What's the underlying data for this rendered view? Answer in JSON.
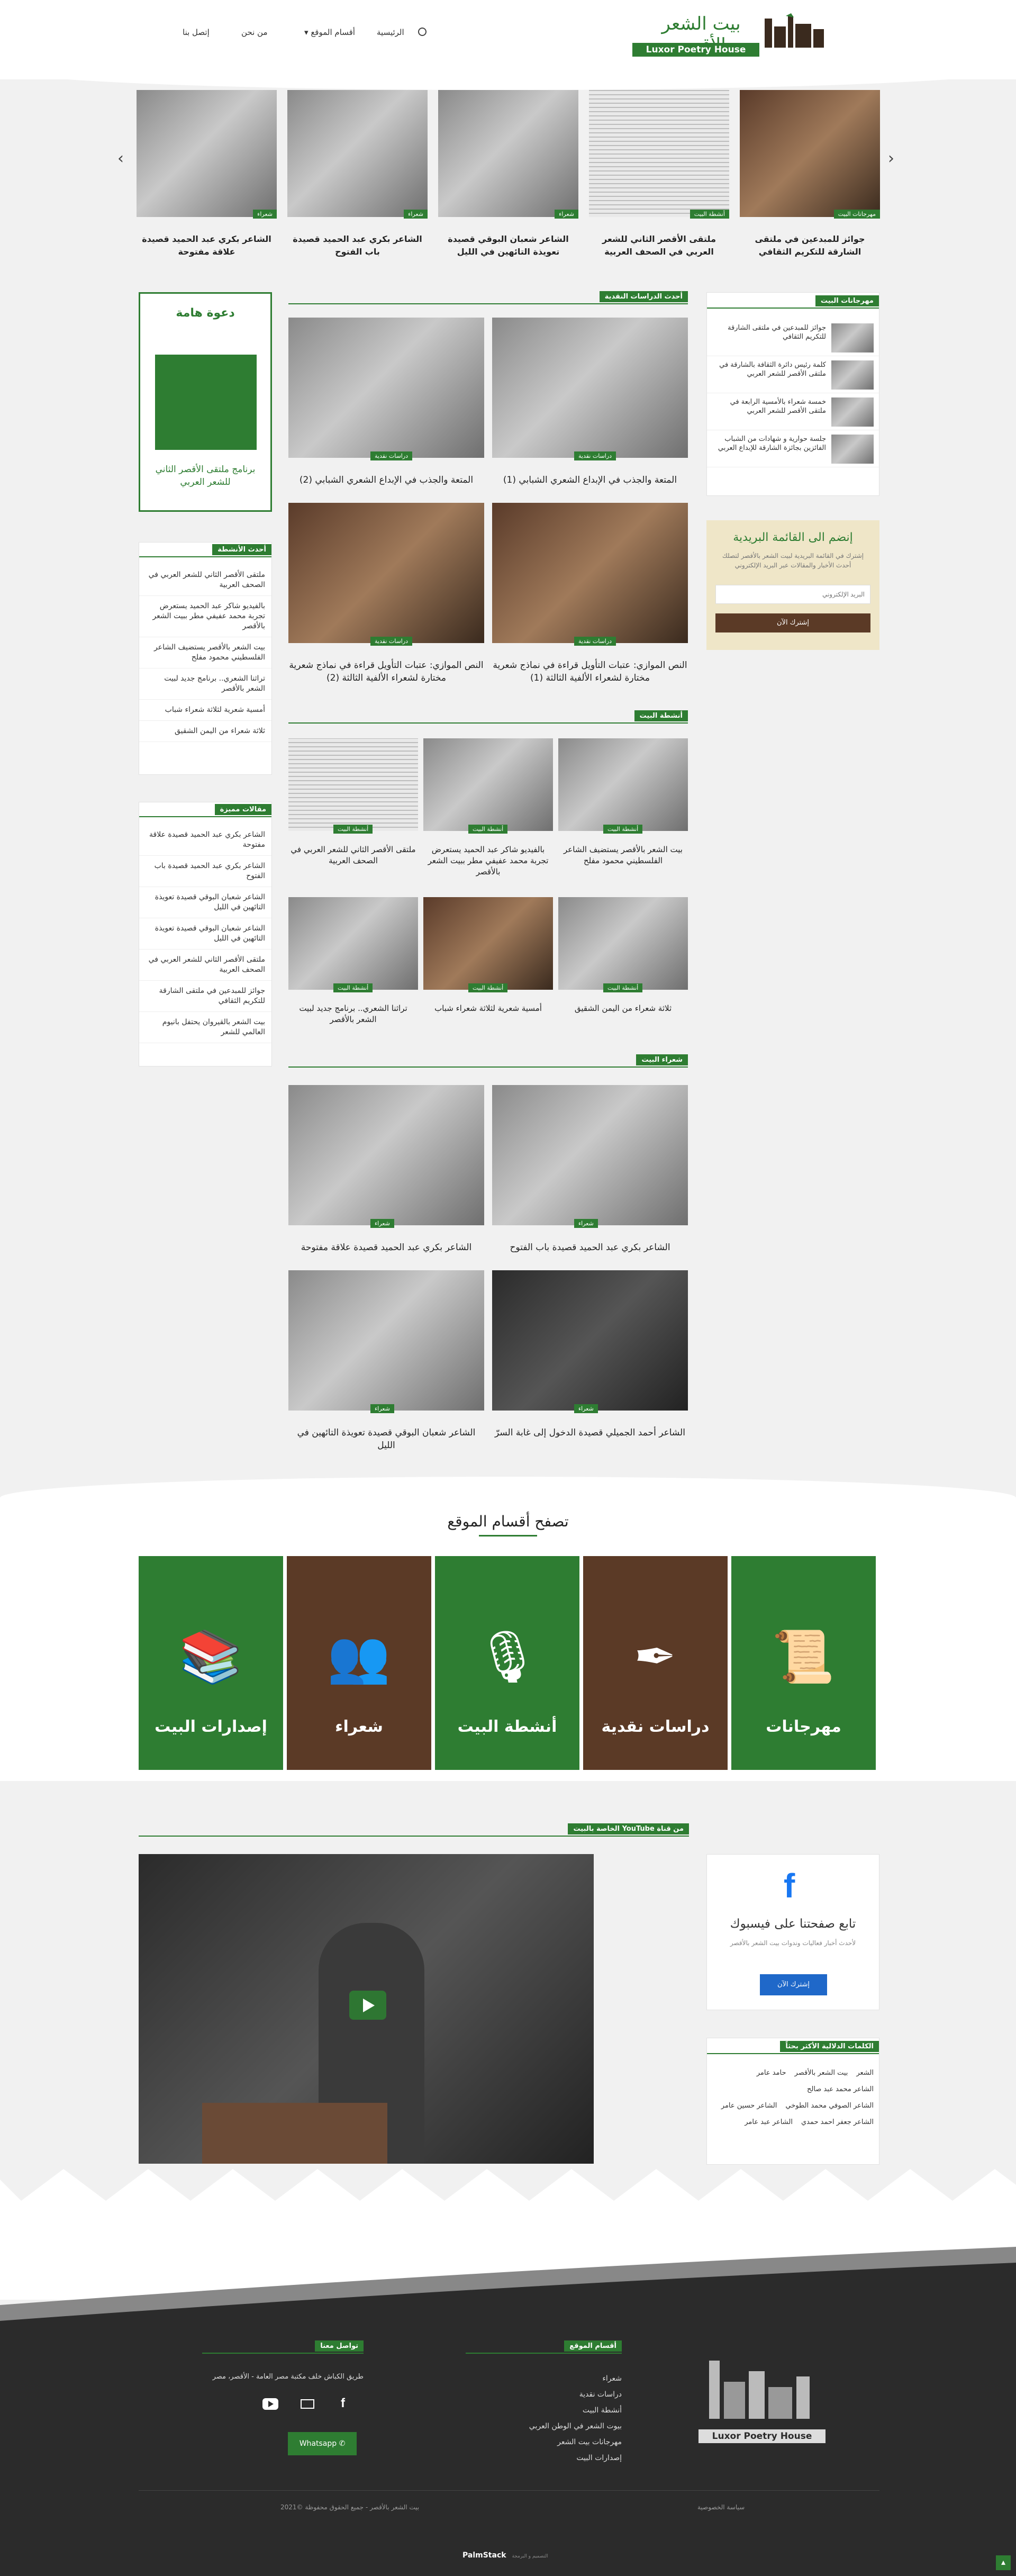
{
  "header": {
    "logo_arabic": "بيت الشعر الأقصر",
    "logo_english": "Luxor Poetry House",
    "nav": [
      "الرئيسية",
      "أقسام الموقع",
      "من نحن",
      "إتصل بنا"
    ]
  },
  "slider": [
    {
      "caption": "جوائز للمبدعين في ملتقى الشارقة للتكريم الثقافي",
      "badge": "مهرجانات البيت"
    },
    {
      "caption": "ملتقى الأقصر الثاني للشعر العربي في الصحف العربية",
      "badge": "أنشطة البيت"
    },
    {
      "caption": "الشاعر شعبان البوقي قصيدة تعويذة التائهين في الليل",
      "badge": "شعراء"
    },
    {
      "caption": "الشاعر بكري عبد الحميد قصيدة باب الفتوح",
      "badge": "شعراء"
    },
    {
      "caption": "الشاعر بكري عبد الحميد قصيدة علاقة مفتوحة",
      "badge": "شعراء"
    }
  ],
  "left_sidebar": {
    "invite_title": "دعوة هامة",
    "invite_text": "برنامج ملتقى الأقصر الثاني للشعر العربي",
    "activities_title": "أحدث الأنشطة",
    "activities": [
      "ملتقى الأقصر الثاني للشعر العربي في الصحف العربية",
      "بالفيديو شاكر عبد الحميد يستعرض تجربة محمد عفيفي مطر ببيت الشعر بالأقصر",
      "بيت الشعر بالأقصر يستضيف الشاعر الفلسطيني محمود مفلح",
      "تراثنا الشعري.. برنامج جديد لبيت الشعر بالأقصر",
      "أمسية شعرية لثلاثة شعراء شباب",
      "ثلاثة شعراء من اليمن الشقيق"
    ],
    "featured_title": "مقالات مميزة",
    "featured": [
      "الشاعر بكري عبد الحميد قصيدة علاقة مفتوحة",
      "الشاعر بكري عبد الحميد قصيدة باب الفتوح",
      "الشاعر شعبان البوقي قصيدة تعويذة التائهين في الليل",
      "الشاعر شعبان البوقي قصيدة تعويذة التائهين في الليل",
      "ملتقى الأقصر الثاني للشعر العربي في الصحف العربية",
      "جوائز للمبدعين في ملتقى الشارقة للتكريم الثقافي",
      "بيت الشعر بالقيروان يحتفل بانيوم العالمي للشعر"
    ]
  },
  "studies": {
    "title": "أحدث الدراسات النقدية",
    "badge": "دراسات نقدية",
    "items": [
      "المتعة والجذب في الإبداع الشعري الشبابي (1)",
      "المتعة والجذب في الإبداع الشعري الشبابي (2)",
      "النص الموازي: عتبات التأويل قراءة في نماذج شعرية مختارة لشعراء الألفية الثالثة (1)",
      "النص الموازي: عتبات التأويل قراءة في نماذج شعرية مختارة لشعراء الألفية الثالثة (2)"
    ]
  },
  "activities": {
    "title": "أنشطة البيت",
    "badge": "أنشطة البيت",
    "items": [
      "بيت الشعر بالأقصر يستضيف الشاعر الفلسطيني محمود مفلح",
      "بالفيديو شاكر عبد الحميد يستعرض تجربة محمد عفيفي مطر ببيت الشعر بالأقصر",
      "ملتقى الأقصر الثاني للشعر العربي في الصحف العربية",
      "ثلاثة شعراء من اليمن الشقيق",
      "أمسية شعرية لثلاثة شعراء شباب",
      "تراثنا الشعري.. برنامج جديد لبيت الشعر بالأقصر"
    ]
  },
  "poets": {
    "title": "شعراء البيت",
    "badge": "شعراء",
    "items": [
      "الشاعر بكري عبد الحميد قصيدة باب الفتوح",
      "الشاعر بكري عبد الحميد قصيدة علاقة مفتوحة",
      "الشاعر أحمد الجميلي قصيدة الدخول إلى غابة السرّ",
      "الشاعر شعبان البوقي قصيدة تعويذة التائهين في الليل"
    ]
  },
  "right_sidebar": {
    "festivals_title": "مهرجانات البيت",
    "festivals": [
      "جوائز للمبدعين في ملتقى الشارقة للتكريم الثقافي",
      "كلمة رئيس دائرة الثقافة بالشارقة في ملتقى الأقصر للشعر العربي",
      "خمسة شعراء بالأمسية الرابعة في ملتقى الأقصر للشعر العربي",
      "جلسة حوارية و شهادات من الشباب الفائزين بجائزة الشارقة للإبداع العربي"
    ],
    "newsletter_title": "إنضم الى القائمة البريدية",
    "newsletter_text": "إشترك في القائمة البريدية لبيت الشعر بالأقصر لتصلك أحدث الأخبار والمقالات عبر البريد الإلكتروني",
    "newsletter_placeholder": "البريد الإلكتروني",
    "newsletter_button": "إشترك الآن"
  },
  "browse": {
    "title": "تصفح أقسام الموقع",
    "tiles": [
      "مهرجانات",
      "دراسات نقدية",
      "أنشطة البيت",
      "شعراء",
      "إصدارات البيت"
    ]
  },
  "youtube": {
    "title": "من قناة YouTube الخاصة بالبيت"
  },
  "facebook": {
    "title": "تابع صفحتنا على فيسبوك",
    "text": "لأحدث أخبار فعاليات وندوات بيت الشعر بالأقصر",
    "button": "إشترك الآن"
  },
  "tags": {
    "title": "الكلمات الدلالية الأكثر بحثاً",
    "items": [
      "الشعر",
      "بيت الشعر بالأقصر",
      "حامد عامر",
      "الشاعر محمد عبد صالح",
      "الشاعر الصوفي محمد الطوخي",
      "الشاعر حسين عامر",
      "الشاعر جعفر احمد حمدي",
      "الشاعر عبد عامر"
    ]
  },
  "footer": {
    "contact_title": "تواصل معنا",
    "address": "طريق الكباش خلف مكتبة مصر العامة - الأقصر، مصر",
    "whatsapp": "Whatsapp",
    "sections_title": "أقسام الموقع",
    "sections": [
      "شعراء",
      "دراسات نقدية",
      "أنشطة البيت",
      "بيوت الشعر في الوطن العربي",
      "مهرجانات بيت الشعر",
      "إصدارات البيت"
    ],
    "copyright": "بيت الشعر بالأقصر - جميع الحقوق محفوظة ©2021",
    "privacy": "سياسة الخصوصية",
    "credit": "PalmStack",
    "credit_sub": "التصميم و البرمجة"
  },
  "colors": {
    "green": "#2e7d32",
    "brown": "#5b3a26",
    "footer": "#2b2b2b"
  }
}
